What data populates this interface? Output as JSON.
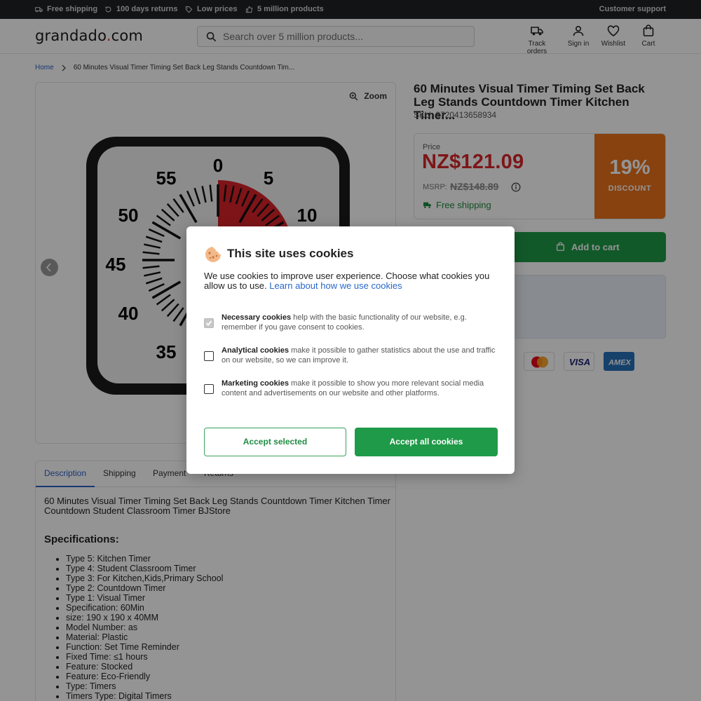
{
  "topbar": {
    "usps": [
      {
        "label": "Free shipping",
        "icon": "truck-icon"
      },
      {
        "label": "100 days returns",
        "icon": "return-icon"
      },
      {
        "label": "Low prices",
        "icon": "tag-icon"
      },
      {
        "label": "5 million products",
        "icon": "thumbs-up-icon"
      }
    ],
    "support": "Customer support"
  },
  "header": {
    "logo_main": "grandado",
    "logo_dot": ".",
    "logo_tld": "com",
    "search_placeholder": "Search over 5 million products...",
    "items": [
      {
        "label": "Track orders",
        "icon": "truck-icon"
      },
      {
        "label": "Sign in",
        "icon": "user-icon"
      },
      {
        "label": "Wishlist",
        "icon": "heart-icon"
      },
      {
        "label": "Cart",
        "icon": "bag-icon"
      }
    ]
  },
  "breadcrumb": {
    "home": "Home",
    "current": "60 Minutes Visual Timer Timing Set Back Leg Stands Countdown Tim..."
  },
  "gallery": {
    "zoom_label": "Zoom",
    "timer_numbers": [
      "0",
      "5",
      "10",
      "35",
      "40",
      "45",
      "50",
      "55"
    ]
  },
  "product": {
    "title": "60 Minutes Visual Timer Timing Set Back Leg Stands Countdown Timer Kitchen Timer...",
    "sku": "SKU: 8720413658934",
    "price_label": "Price",
    "price": "NZ$121.09",
    "msrp_label": "MSRP:",
    "msrp": "NZ$148.89",
    "shipping": "Free shipping",
    "discount_pct": "19%",
    "discount_label": "DISCOUNT",
    "cart_label": "Add to cart",
    "payment_cards": [
      "mastercard-icon",
      "visa-icon",
      "amex-icon"
    ],
    "visa_text": "VISA",
    "amex_text": "AMEX"
  },
  "tabs": [
    "Description",
    "Shipping",
    "Payment",
    "Returns"
  ],
  "description": {
    "text": "60 Minutes Visual Timer Timing Set Back Leg Stands Countdown Timer Kitchen Timer Countdown Student Classroom Timer BJStore",
    "spec_heading": "Specifications:",
    "specs": [
      "Type 5: Kitchen Timer",
      "Type 4: Student Classroom Timer",
      "Type 3: For Kitchen,Kids,Primary School",
      "Type 2: Countdown Timer",
      "Type 1: Visual Timer",
      "Specification: 60Min",
      "size: 190 x 190 x 40MM",
      "Model Number: as",
      "Material: Plastic",
      "Function: Set Time Reminder",
      "Fixed Time: ≤1 hours",
      "Feature: Stocked",
      "Feature: Eco-Friendly",
      "Type: Timers",
      "Timers Type: Digital Timers"
    ]
  },
  "cookie_modal": {
    "title": "This site uses cookies",
    "intro": "We use cookies to improve user experience. Choose what cookies you allow us to use.",
    "intro_link": "Learn about how we use cookies",
    "options": [
      {
        "name": "Necessary cookies",
        "text": "help with the basic functionality of our website, e.g. remember if you gave consent to cookies.",
        "checked": true
      },
      {
        "name": "Analytical cookies",
        "text": "make it possible to gather statistics about the use and traffic on our website, so we can improve it.",
        "checked": false
      },
      {
        "name": "Marketing cookies",
        "text": "make it possible to show you more relevant social media content and advertisements on our website and other platforms.",
        "checked": false
      }
    ],
    "accept_selected": "Accept selected",
    "accept_all": "Accept all cookies"
  },
  "colors": {
    "accent_green": "#1f9a48",
    "price_red": "#d8262c",
    "discount_orange": "#e8731c",
    "link_blue": "#2b5fc7"
  }
}
